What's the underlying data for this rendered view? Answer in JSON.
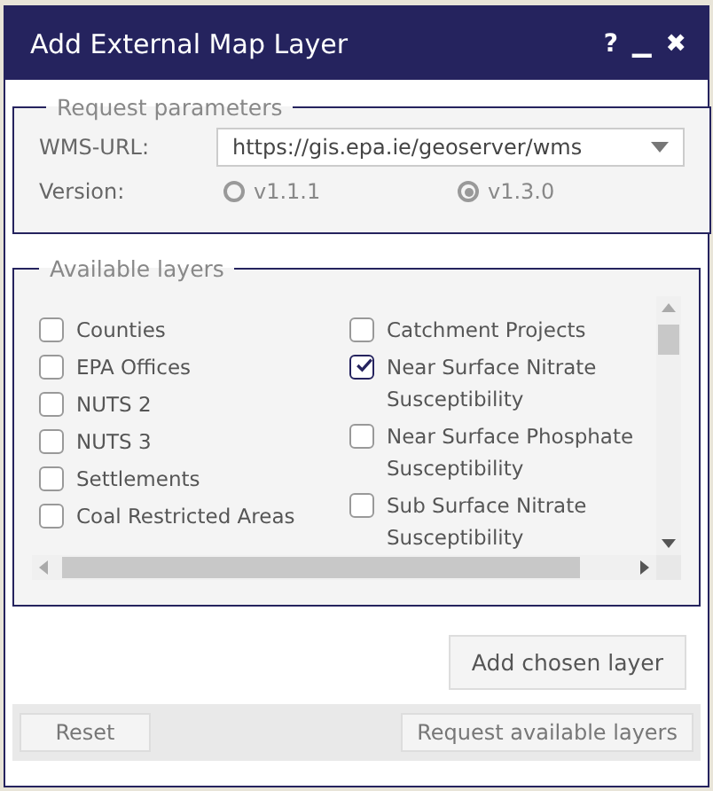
{
  "window": {
    "title": "Add External Map Layer",
    "controls": [
      "?",
      "▁",
      "✖"
    ]
  },
  "request_parameters": {
    "legend": "Request parameters",
    "url_label": "WMS-URL:",
    "url_value": "https://gis.epa.ie/geoserver/wms",
    "version_label": "Version:",
    "versions": [
      {
        "label": "v1.1.1",
        "selected": false
      },
      {
        "label": "v1.3.0",
        "selected": true
      }
    ]
  },
  "available_layers": {
    "legend": "Available layers",
    "columns": [
      [
        {
          "label": "Counties",
          "checked": false
        },
        {
          "label": "EPA Offices",
          "checked": false
        },
        {
          "label": "NUTS 2",
          "checked": false
        },
        {
          "label": "NUTS 3",
          "checked": false
        },
        {
          "label": "Settlements",
          "checked": false
        },
        {
          "label": "Coal Restricted Areas",
          "checked": false
        }
      ],
      [
        {
          "label": "Catchment Projects",
          "checked": false
        },
        {
          "label": "Near Surface Nitrate Susceptibility",
          "checked": true
        },
        {
          "label": "Near Surface Phosphate Susceptibility",
          "checked": false
        },
        {
          "label": "Sub Surface Nitrate Susceptibility",
          "checked": false
        }
      ]
    ]
  },
  "add_button": "Add chosen layer",
  "footer": {
    "reset": "Reset",
    "request": "Request available layers"
  }
}
